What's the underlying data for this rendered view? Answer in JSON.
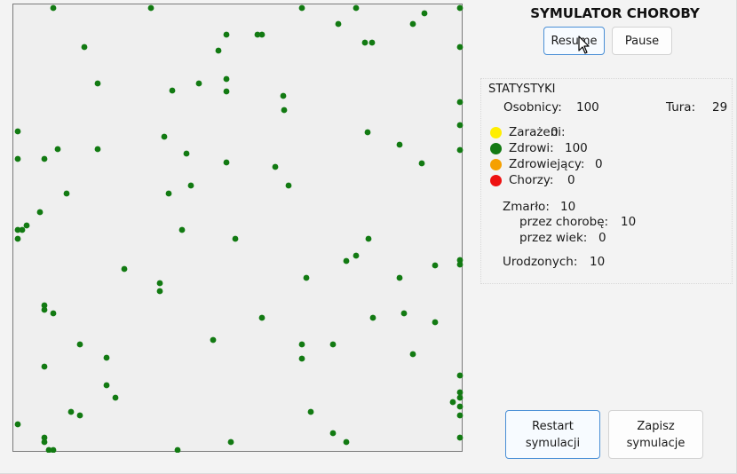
{
  "app": {
    "title": "SYMULATOR CHOROBY"
  },
  "controls": {
    "resume_label": "Resume",
    "pause_label": "Pause",
    "restart_label_line1": "Restart",
    "restart_label_line2": "symulacji",
    "save_label_line1": "Zapisz",
    "save_label_line2": "symulacje"
  },
  "stats": {
    "header": "STATYSTYKI",
    "individuals_label": "Osobnicy:",
    "individuals_value": "100",
    "turn_label": "Tura:",
    "turn_value": "29",
    "legend": [
      {
        "label": "Zarażeni:",
        "value": "0",
        "color": "#ffee00"
      },
      {
        "label": "Zdrowi:",
        "value": "100",
        "color": "#137a13"
      },
      {
        "label": "Zdrowiejący:",
        "value": "0",
        "color": "#f5a000"
      },
      {
        "label": "Chorzy:",
        "value": "0",
        "color": "#ee1111"
      }
    ],
    "died_label": "Zmarło:",
    "died_value": "10",
    "died_disease_label": "przez chorobę:",
    "died_disease_value": "10",
    "died_age_label": "przez wiek:",
    "died_age_value": "0",
    "born_label": "Urodzonych:",
    "born_value": "10"
  },
  "simulation": {
    "healthy_color": "#127a12",
    "individuals": [
      [
        59,
        8
      ],
      [
        169,
        8
      ],
      [
        339,
        8
      ],
      [
        400,
        8
      ],
      [
        517,
        8
      ],
      [
        380,
        26
      ],
      [
        477,
        14
      ],
      [
        464,
        26
      ],
      [
        254,
        38
      ],
      [
        289,
        38
      ],
      [
        294,
        38
      ],
      [
        94,
        52
      ],
      [
        410,
        47
      ],
      [
        418,
        47
      ],
      [
        245,
        56
      ],
      [
        517,
        52
      ],
      [
        109,
        93
      ],
      [
        254,
        88
      ],
      [
        193,
        101
      ],
      [
        223,
        93
      ],
      [
        254,
        102
      ],
      [
        318,
        107
      ],
      [
        319,
        123
      ],
      [
        517,
        114
      ],
      [
        19,
        147
      ],
      [
        184,
        153
      ],
      [
        413,
        148
      ],
      [
        517,
        140
      ],
      [
        64,
        167
      ],
      [
        109,
        167
      ],
      [
        19,
        178
      ],
      [
        49,
        178
      ],
      [
        209,
        172
      ],
      [
        449,
        162
      ],
      [
        517,
        168
      ],
      [
        254,
        182
      ],
      [
        309,
        187
      ],
      [
        474,
        183
      ],
      [
        74,
        217
      ],
      [
        189,
        217
      ],
      [
        214,
        208
      ],
      [
        324,
        208
      ],
      [
        44,
        238
      ],
      [
        29,
        253
      ],
      [
        19,
        258
      ],
      [
        24,
        258
      ],
      [
        19,
        268
      ],
      [
        204,
        258
      ],
      [
        264,
        268
      ],
      [
        414,
        268
      ],
      [
        400,
        287
      ],
      [
        389,
        293
      ],
      [
        489,
        298
      ],
      [
        517,
        292
      ],
      [
        517,
        297
      ],
      [
        139,
        302
      ],
      [
        344,
        312
      ],
      [
        449,
        312
      ],
      [
        179,
        318
      ],
      [
        179,
        327
      ],
      [
        49,
        343
      ],
      [
        49,
        348
      ],
      [
        59,
        352
      ],
      [
        294,
        357
      ],
      [
        419,
        357
      ],
      [
        454,
        352
      ],
      [
        489,
        362
      ],
      [
        239,
        382
      ],
      [
        89,
        387
      ],
      [
        339,
        387
      ],
      [
        374,
        387
      ],
      [
        464,
        398
      ],
      [
        119,
        402
      ],
      [
        339,
        403
      ],
      [
        49,
        412
      ],
      [
        517,
        422
      ],
      [
        119,
        433
      ],
      [
        129,
        447
      ],
      [
        517,
        441
      ],
      [
        517,
        447
      ],
      [
        509,
        452
      ],
      [
        517,
        457
      ],
      [
        79,
        463
      ],
      [
        89,
        467
      ],
      [
        349,
        463
      ],
      [
        517,
        467
      ],
      [
        19,
        477
      ],
      [
        374,
        487
      ],
      [
        49,
        492
      ],
      [
        49,
        497
      ],
      [
        259,
        497
      ],
      [
        389,
        497
      ],
      [
        517,
        492
      ],
      [
        54,
        507
      ],
      [
        59,
        507
      ],
      [
        199,
        507
      ]
    ]
  }
}
